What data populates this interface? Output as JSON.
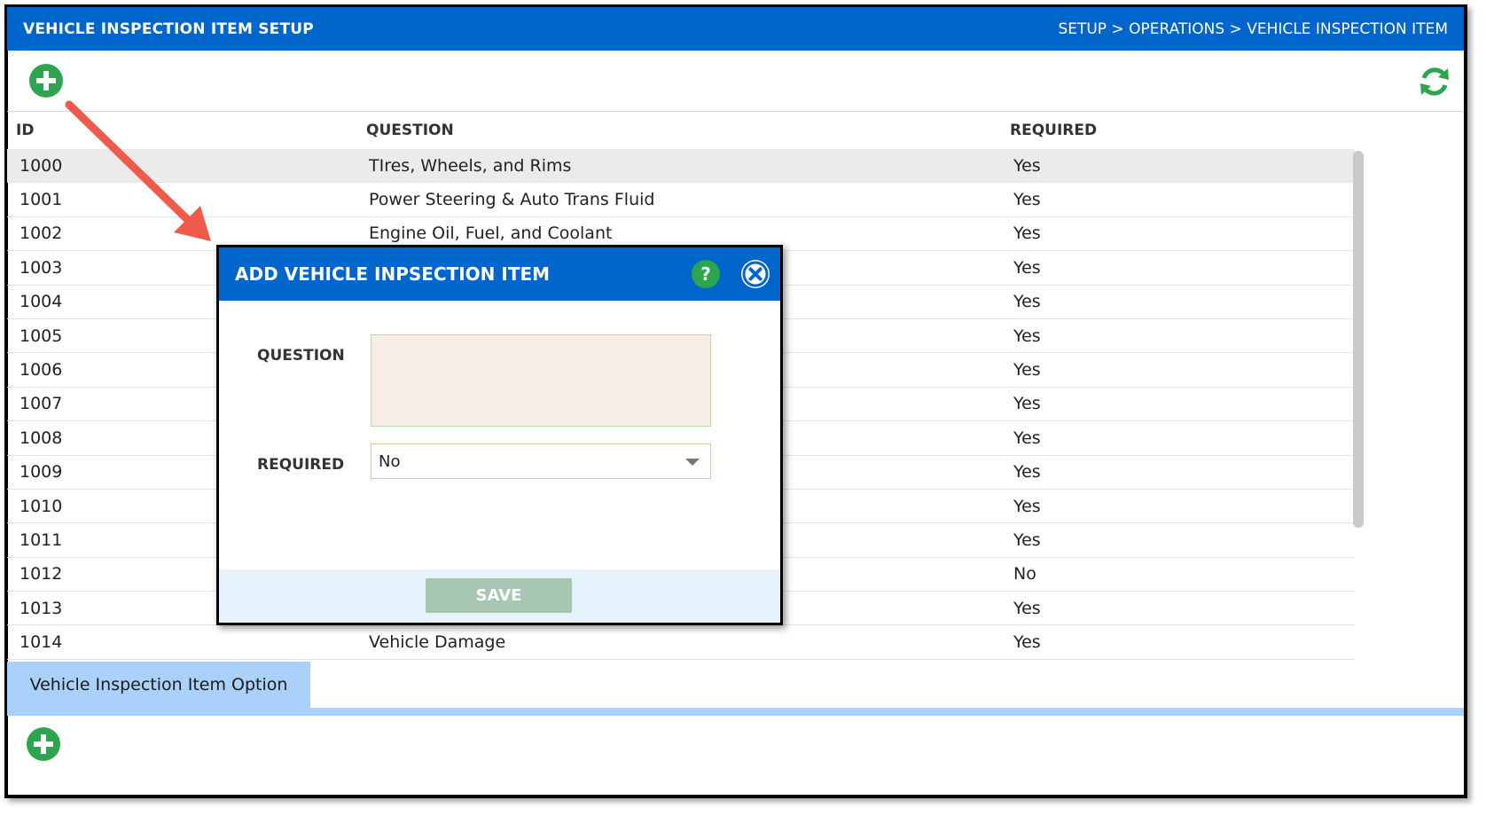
{
  "header": {
    "title": "VEHICLE INSPECTION ITEM SETUP",
    "breadcrumb": "SETUP > OPERATIONS > VEHICLE INSPECTION ITEM"
  },
  "grid": {
    "columns": {
      "id": "ID",
      "question": "QUESTION",
      "required": "REQUIRED"
    },
    "rows": [
      {
        "id": "1000",
        "question": "TIres, Wheels, and Rims",
        "required": "Yes"
      },
      {
        "id": "1001",
        "question": "Power Steering & Auto Trans Fluid",
        "required": "Yes"
      },
      {
        "id": "1002",
        "question": "Engine Oil, Fuel, and Coolant",
        "required": "Yes"
      },
      {
        "id": "1003",
        "question": "",
        "required": "Yes"
      },
      {
        "id": "1004",
        "question": "",
        "required": "Yes"
      },
      {
        "id": "1005",
        "question": "",
        "required": "Yes"
      },
      {
        "id": "1006",
        "question": "",
        "required": "Yes"
      },
      {
        "id": "1007",
        "question": "",
        "required": "Yes"
      },
      {
        "id": "1008",
        "question": "",
        "required": "Yes"
      },
      {
        "id": "1009",
        "question": "",
        "required": "Yes"
      },
      {
        "id": "1010",
        "question": "",
        "required": "Yes"
      },
      {
        "id": "1011",
        "question": "",
        "required": "Yes"
      },
      {
        "id": "1012",
        "question": "",
        "required": "No"
      },
      {
        "id": "1013",
        "question": "",
        "required": "Yes"
      },
      {
        "id": "1014",
        "question": "Vehicle Damage",
        "required": "Yes"
      }
    ]
  },
  "subtab": {
    "label": "Vehicle Inspection Item Option"
  },
  "modal": {
    "title": "ADD VEHICLE INPSECTION ITEM",
    "help_icon": "?",
    "question_label": "QUESTION",
    "question_value": "",
    "required_label": "REQUIRED",
    "required_value": "No",
    "save_label": "SAVE"
  },
  "colors": {
    "brand_blue": "#0066cc",
    "action_green": "#2da44e",
    "arrow_red": "#f05a4a"
  }
}
